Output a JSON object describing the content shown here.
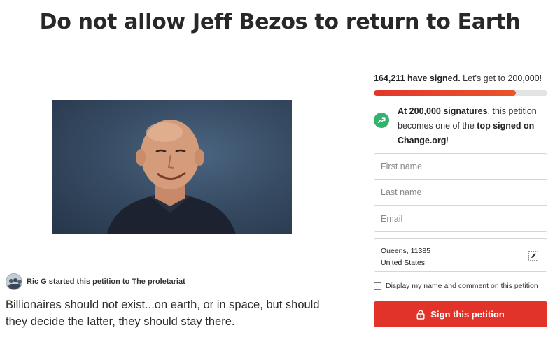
{
  "petition": {
    "title": "Do not allow Jeff Bezos to return to Earth",
    "starter_name": "Ric G",
    "starter_rest": " started this petition to The proletariat",
    "description": "Billionaires should not exist...on earth, or in space, but should they decide the latter, they should stay there."
  },
  "signatures": {
    "count_bold": "164,211 have signed.",
    "count_rest": " Let's get to 200,000!",
    "progress_fraction": 0.82,
    "milestone_a": "At 200,000 signatures",
    "milestone_b": ", this petition becomes one of the ",
    "milestone_c": "top signed on Change.org",
    "milestone_d": "!"
  },
  "form": {
    "first_name_placeholder": "First name",
    "last_name_placeholder": "Last name",
    "email_placeholder": "Email",
    "location_line1": "Queens, 11385",
    "location_line2": "United States",
    "display_label": "Display my name and comment on this petition",
    "sign_label": "Sign this petition"
  },
  "colors": {
    "accent": "#e2332b",
    "milestone_icon": "#2fb36d"
  },
  "icons": {
    "milestone": "trending-up-icon",
    "edit": "edit-pencil-icon",
    "sign": "lock-icon"
  }
}
